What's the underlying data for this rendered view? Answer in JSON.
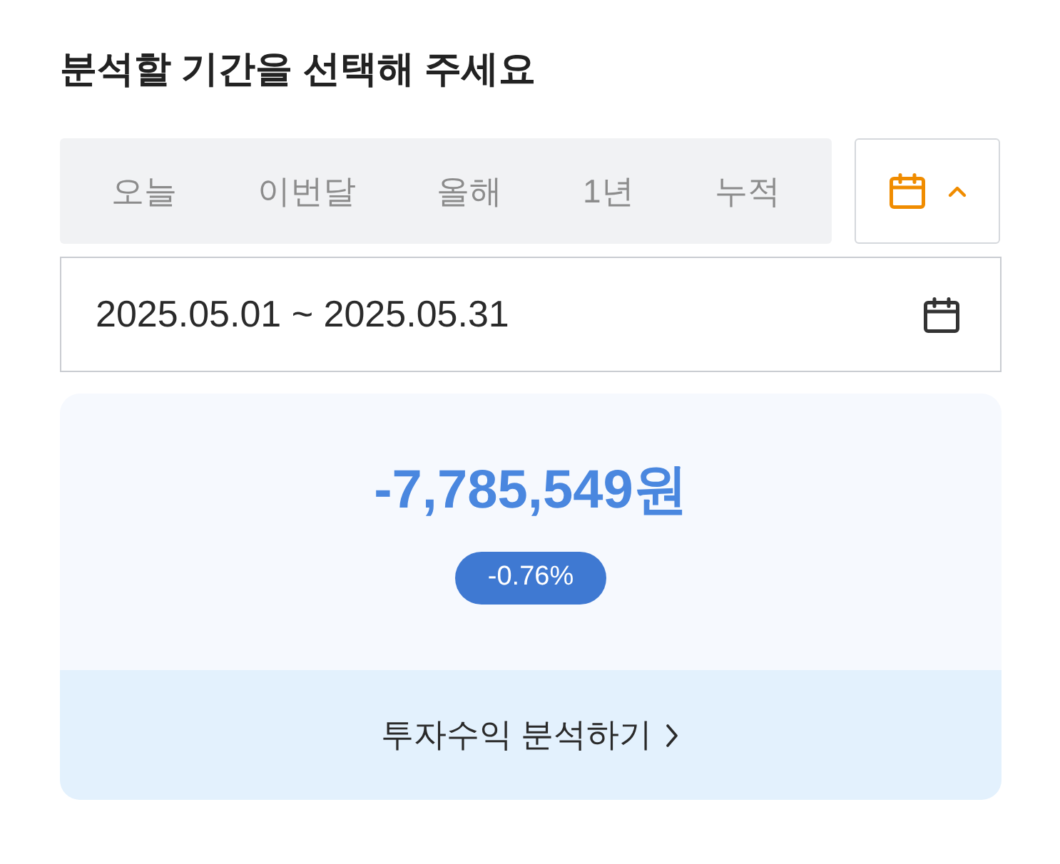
{
  "title": "분석할 기간을 선택해 주세요",
  "tabs": [
    {
      "label": "오늘",
      "selected": false
    },
    {
      "label": "이번달",
      "selected": false
    },
    {
      "label": "올해",
      "selected": false
    },
    {
      "label": "1년",
      "selected": false
    },
    {
      "label": "누적",
      "selected": false
    }
  ],
  "calendar_toggle": {
    "expanded": true
  },
  "date_range": {
    "value": "2025.05.01 ~ 2025.05.31"
  },
  "summary": {
    "amount": "-7,785,549원",
    "rate": "-0.76%",
    "link": "투자수익 분석하기"
  }
}
